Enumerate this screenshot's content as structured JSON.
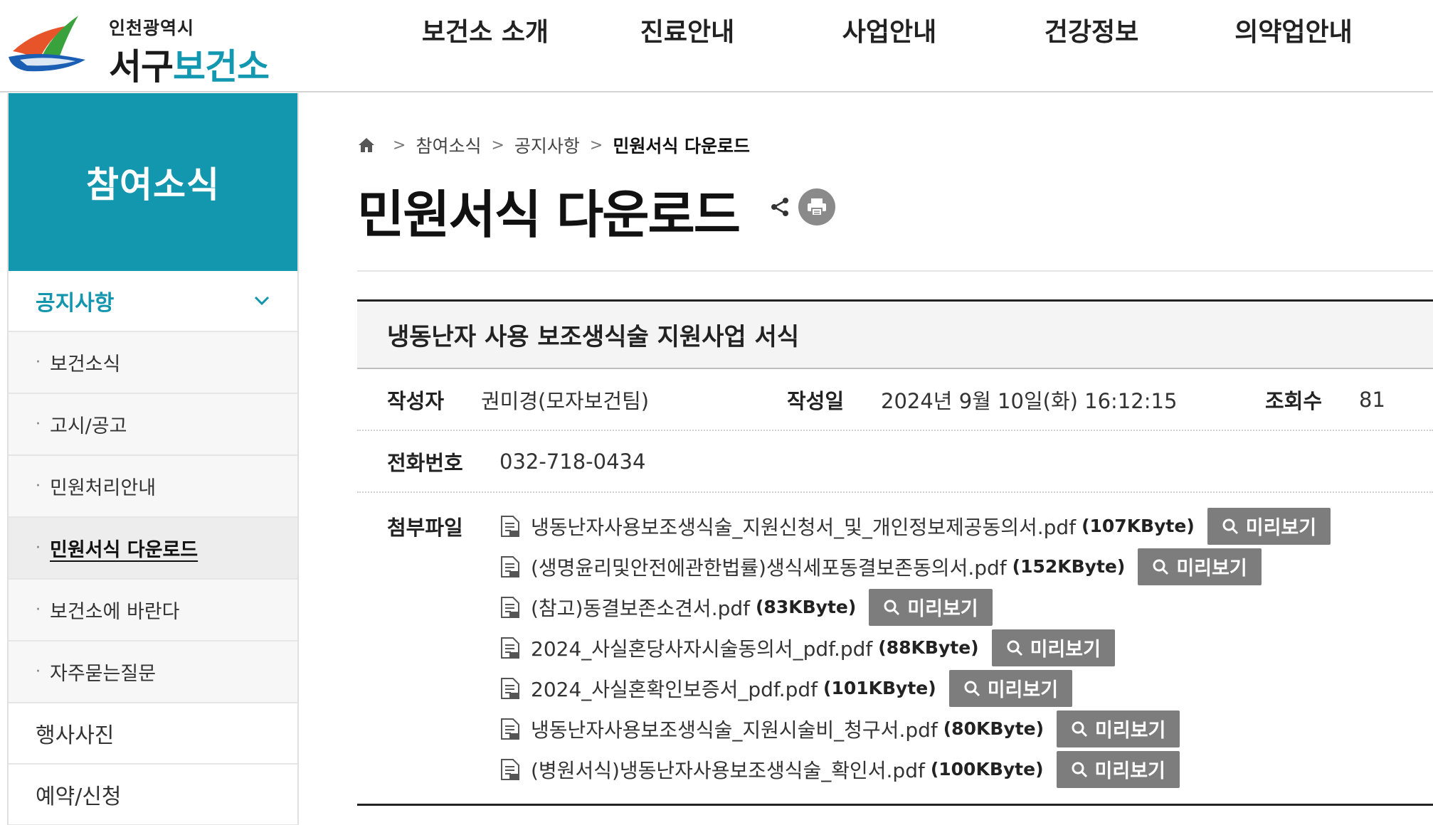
{
  "header": {
    "logo_city": "인천광역시",
    "logo_name_prefix": "서구",
    "logo_name_accent": "보건소",
    "nav": [
      "보건소 소개",
      "진료안내",
      "사업안내",
      "건강정보",
      "의약업안내"
    ]
  },
  "sidebar": {
    "title": "참여소식",
    "section": "공지사항",
    "sub_items": [
      {
        "label": "보건소식"
      },
      {
        "label": "고시/공고"
      },
      {
        "label": "민원처리안내"
      },
      {
        "label": "민원서식 다운로드",
        "active": true
      },
      {
        "label": "보건소에 바란다"
      },
      {
        "label": "자주묻는질문"
      }
    ],
    "top_items": [
      "행사사진",
      "예약/신청"
    ]
  },
  "breadcrumb": {
    "items": [
      "참여소식",
      "공지사항"
    ],
    "current": "민원서식 다운로드"
  },
  "page_title": "민원서식 다운로드",
  "post": {
    "subject": "냉동난자 사용 보조생식술 지원사업 서식",
    "author_label": "작성자",
    "author": "권미경(모자보건팀)",
    "date_label": "작성일",
    "date": "2024년 9월 10일(화) 16:12:15",
    "views_label": "조회수",
    "views": "81",
    "phone_label": "전화번호",
    "phone": "032-718-0434",
    "files_label": "첨부파일",
    "preview_label": "미리보기",
    "files": [
      {
        "name": "냉동난자사용보조생식술_지원신청서_및_개인정보제공동의서.pdf",
        "size": "(107KByte)"
      },
      {
        "name": "(생명윤리및안전에관한법률)생식세포동결보존동의서.pdf",
        "size": "(152KByte)"
      },
      {
        "name": "(참고)동결보존소견서.pdf",
        "size": "(83KByte)"
      },
      {
        "name": "2024_사실혼당사자시술동의서_pdf.pdf",
        "size": "(88KByte)"
      },
      {
        "name": "2024_사실혼확인보증서_pdf.pdf",
        "size": "(101KByte)"
      },
      {
        "name": "냉동난자사용보조생식술_지원시술비_청구서.pdf",
        "size": "(80KByte)"
      },
      {
        "name": "(병원서식)냉동난자사용보조생식술_확인서.pdf",
        "size": "(100KByte)"
      }
    ]
  },
  "colors": {
    "brand_teal": "#1397ae",
    "preview_button": "#7d7d7d",
    "logo_orange": "#e8542a",
    "logo_green": "#3aa23c",
    "logo_blue": "#1a5fb4"
  },
  "icons": {
    "home": "home-icon",
    "share": "share-icon",
    "print": "print-icon",
    "file": "pdf-file-icon",
    "search": "search-icon",
    "chevron": "chevron-down-icon"
  }
}
